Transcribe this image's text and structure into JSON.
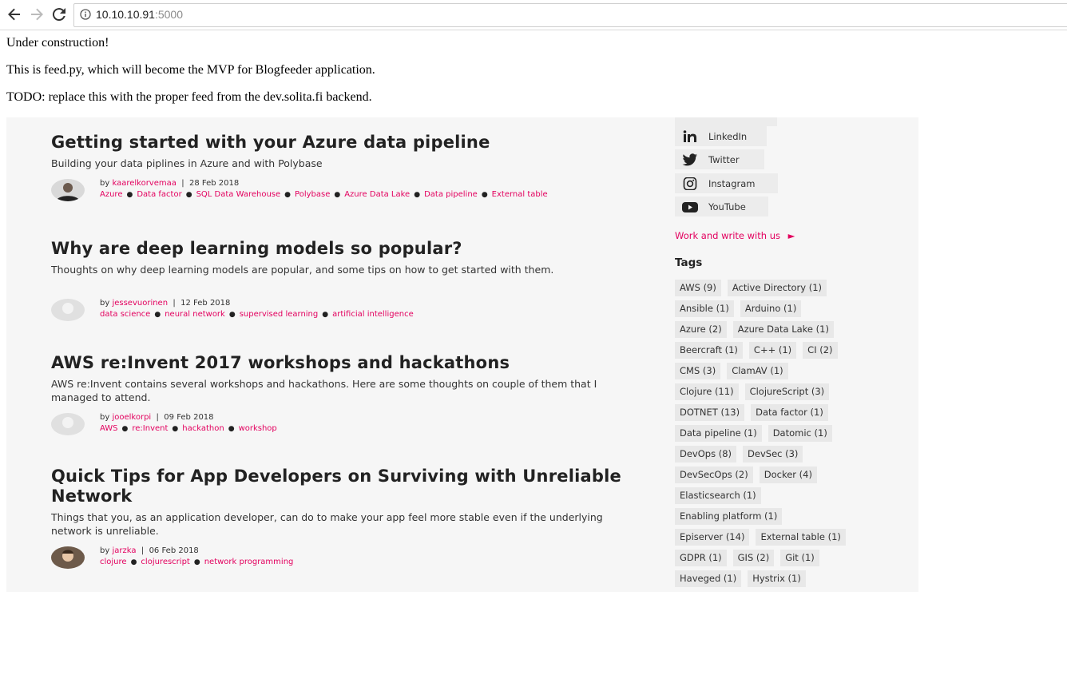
{
  "browser": {
    "url_host": "10.10.10.91",
    "url_port": ":5000"
  },
  "page": {
    "line1": "Under construction!",
    "line2": "This is feed.py, which will become the MVP for Blogfeeder application.",
    "line3": "TODO: replace this with the proper feed from the dev.solita.fi backend."
  },
  "posts": [
    {
      "title": "Getting started with your Azure data pipeline",
      "desc": "Building your data piplines in Azure and with Polybase",
      "by": "by",
      "author": "kaarelkorvemaa",
      "date": "28 Feb 2018",
      "tags": [
        "Azure",
        "Data factor",
        "SQL Data Warehouse",
        "Polybase",
        "Azure Data Lake",
        "Data pipeline",
        "External table"
      ]
    },
    {
      "title": "Why are deep learning models so popular?",
      "desc": "Thoughts on why deep learning models are popular, and some tips on how to get started with them.",
      "by": "by",
      "author": "jessevuorinen",
      "date": "12 Feb 2018",
      "tags": [
        "data science",
        "neural network",
        "supervised learning",
        "artificial intelligence"
      ]
    },
    {
      "title": "AWS re:Invent 2017 workshops and hackathons",
      "desc": "AWS re:Invent contains several workshops and hackathons. Here are some thoughts on couple of them that I managed to attend.",
      "by": "by",
      "author": "jooelkorpi",
      "date": "09 Feb 2018",
      "tags": [
        "AWS",
        "re:Invent",
        "hackathon",
        "workshop"
      ]
    },
    {
      "title": "Quick Tips for App Developers on Surviving with Unreliable Network",
      "desc": "Things that you, as an application developer, can do to make your app feel more stable even if the underlying network is unreliable.",
      "by": "by",
      "author": "jarzka",
      "date": "06 Feb 2018",
      "tags": [
        "clojure",
        "clojurescript",
        "network programming"
      ]
    }
  ],
  "sidebar": {
    "social": [
      {
        "label": "LinkedIn",
        "icon": "linkedin-icon"
      },
      {
        "label": "Twitter",
        "icon": "twitter-icon"
      },
      {
        "label": "Instagram",
        "icon": "instagram-icon"
      },
      {
        "label": "YouTube",
        "icon": "youtube-icon"
      }
    ],
    "work_link": "Work and write with us",
    "tags_title": "Tags",
    "tag_rows": [
      [
        "AWS (9)",
        "Active Directory (1)"
      ],
      [
        "Ansible (1)",
        "Arduino (1)"
      ],
      [
        "Azure (2)",
        "Azure Data Lake (1)"
      ],
      [
        "Beercraft (1)",
        "C++ (1)",
        "CI (2)"
      ],
      [
        "CMS (3)",
        "ClamAV (1)"
      ],
      [
        "Clojure (11)",
        "ClojureScript (3)"
      ],
      [
        "DOTNET (13)",
        "Data factor (1)"
      ],
      [
        "Data pipeline (1)",
        "Datomic (1)"
      ],
      [
        "DevOps (8)",
        "DevSec (3)"
      ],
      [
        "DevSecOps (2)",
        "Docker (4)"
      ],
      [
        "Elasticsearch (1)"
      ],
      [
        "Enabling platform (1)"
      ],
      [
        "Episerver (14)",
        "External table (1)"
      ],
      [
        "GDPR (1)",
        "GIS (2)",
        "Git (1)"
      ],
      [
        "Haveged (1)",
        "Hystrix (1)"
      ]
    ]
  },
  "colors": {
    "accent": "#e3005e",
    "panel_bg": "#f6f6f6",
    "chip_bg": "#e8e8e8"
  }
}
